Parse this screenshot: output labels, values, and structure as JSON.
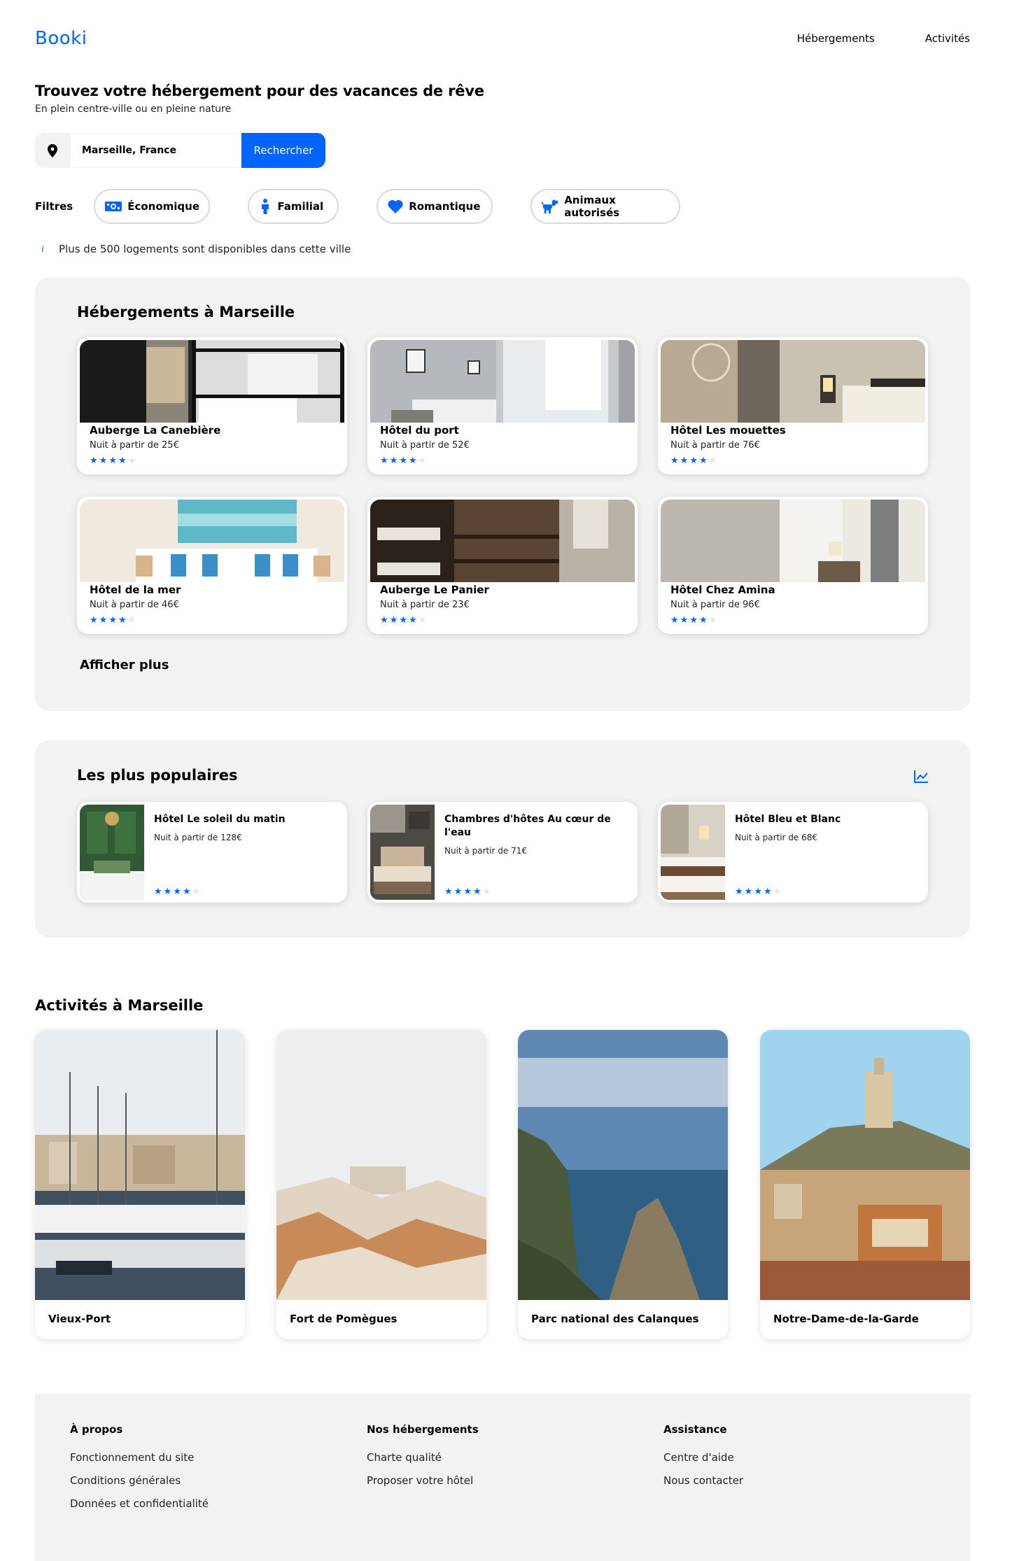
{
  "header": {
    "logo": "Booki",
    "nav": [
      "Hébergements",
      "Activités"
    ]
  },
  "hero": {
    "title": "Trouvez votre hébergement pour des vacances de rêve",
    "subtitle": "En plein centre-ville ou en pleine nature"
  },
  "search": {
    "value": "Marseille, France",
    "button": "Rechercher"
  },
  "filters": {
    "label": "Filtres",
    "items": [
      {
        "label": "Économique",
        "icon": "money-icon"
      },
      {
        "label": "Familial",
        "icon": "person-icon"
      },
      {
        "label": "Romantique",
        "icon": "heart-icon"
      },
      {
        "label": "Animaux autorisés",
        "icon": "dog-icon"
      }
    ]
  },
  "info": "Plus de 500 logements sont disponibles dans cette ville",
  "accommodations": {
    "title": "Hébergements à Marseille",
    "items": [
      {
        "name": "Auberge La Canebière",
        "price": "Nuit à partir de 25€",
        "rating": 4
      },
      {
        "name": "Hôtel du port",
        "price": "Nuit à partir de 52€",
        "rating": 4
      },
      {
        "name": "Hôtel Les mouettes",
        "price": "Nuit à partir de 76€",
        "rating": 4
      },
      {
        "name": "Hôtel de la mer",
        "price": "Nuit à partir de 46€",
        "rating": 4
      },
      {
        "name": "Auberge Le Panier",
        "price": "Nuit à partir de 23€",
        "rating": 4
      },
      {
        "name": "Hôtel Chez Amina",
        "price": "Nuit à partir de 96€",
        "rating": 4
      }
    ],
    "more": "Afficher plus"
  },
  "popular": {
    "title": "Les plus populaires",
    "items": [
      {
        "name": "Hôtel Le soleil du matin",
        "price": "Nuit à partir de 128€",
        "rating": 4
      },
      {
        "name": "Chambres d'hôtes Au cœur de l'eau",
        "price": "Nuit à partir de 71€",
        "rating": 4
      },
      {
        "name": "Hôtel Bleu et Blanc",
        "price": "Nuit à partir de 68€",
        "rating": 4
      }
    ]
  },
  "activities": {
    "title": "Activités à Marseille",
    "items": [
      "Vieux-Port",
      "Fort de Pomègues",
      "Parc national des Calanques",
      "Notre-Dame-de-la-Garde"
    ]
  },
  "footer": {
    "columns": [
      {
        "title": "À propos",
        "links": [
          "Fonctionnement du site",
          "Conditions générales",
          "Données et confidentialité"
        ]
      },
      {
        "title": "Nos hébergements",
        "links": [
          "Charte qualité",
          "Proposer votre hôtel"
        ]
      },
      {
        "title": "Assistance",
        "links": [
          "Centre d'aide",
          "Nous contacter"
        ]
      }
    ]
  },
  "colors": {
    "accent": "#0065fc",
    "panel": "#f2f2f2"
  }
}
